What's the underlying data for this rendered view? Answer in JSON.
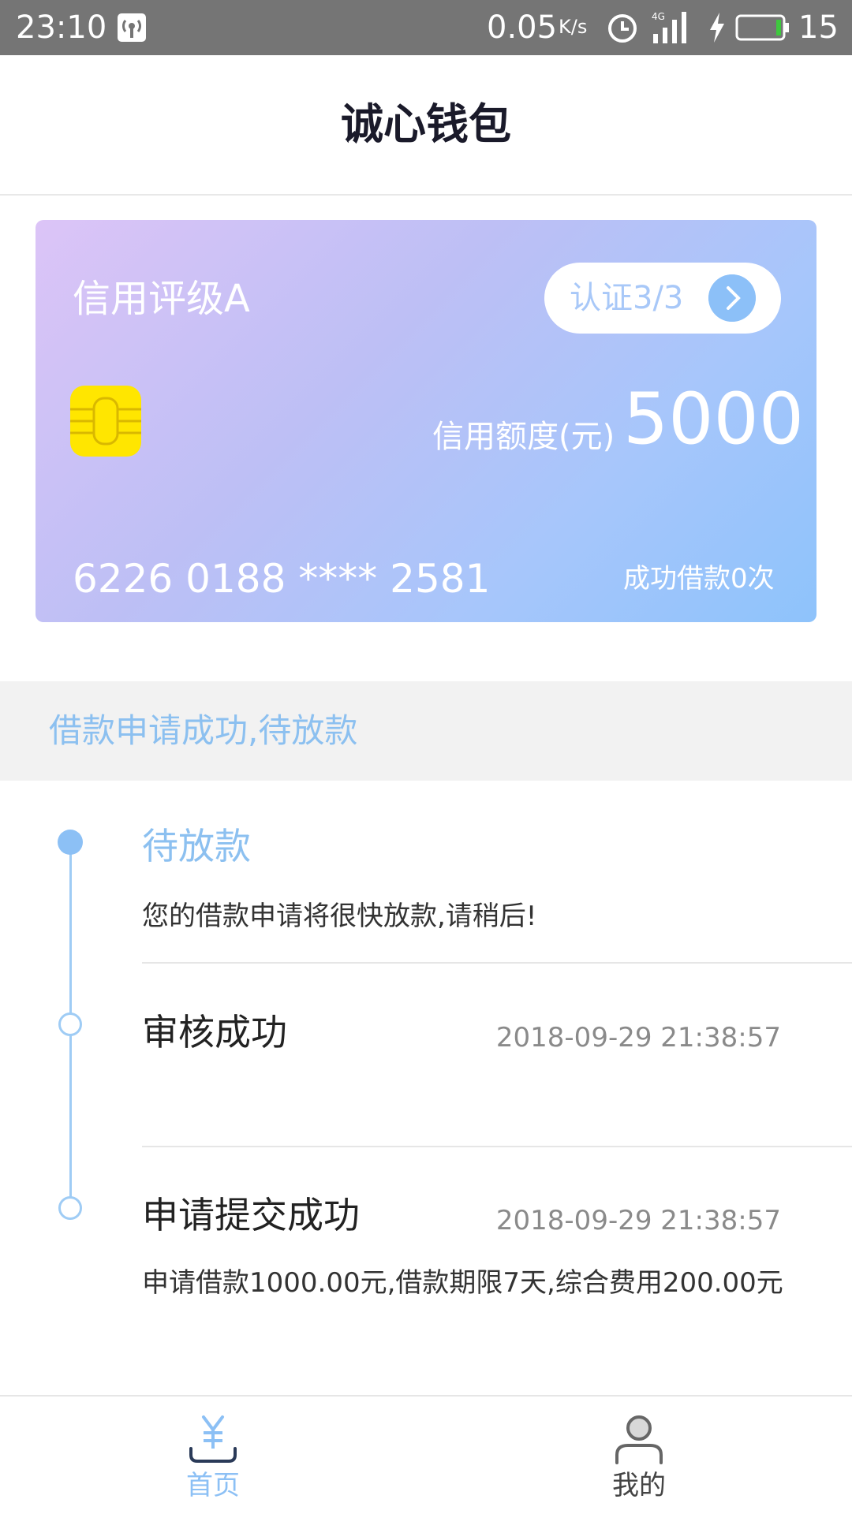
{
  "status_bar": {
    "time": "23:10",
    "net_speed": "0.05",
    "net_speed_unit": "K/s",
    "battery_level": "15",
    "signal_label": "4G"
  },
  "header": {
    "title": "诚心钱包"
  },
  "credit_card": {
    "rating": "信用评级A",
    "auth_label": "认证3/3",
    "limit_label": "信用额度(元)",
    "limit_value": "5000",
    "card_number": "6226 0188 **** 2581",
    "loan_count": "成功借款0次"
  },
  "notice": {
    "text": "借款申请成功,待放款"
  },
  "timeline": [
    {
      "title": "待放款",
      "time": "",
      "desc": "您的借款申请将很快放款,请稍后!",
      "active": true
    },
    {
      "title": "审核成功",
      "time": "2018-09-29 21:38:57",
      "desc": "",
      "active": false
    },
    {
      "title": "申请提交成功",
      "time": "2018-09-29 21:38:57",
      "desc": "申请借款1000.00元,借款期限7天,综合费用200.00元",
      "active": false
    }
  ],
  "bottom_nav": {
    "home_label": "首页",
    "mine_label": "我的"
  },
  "colors": {
    "accent": "#8cc0f5",
    "status_bar": "#757575",
    "chip": "#ffe600",
    "inactive_nav": "#666666"
  }
}
